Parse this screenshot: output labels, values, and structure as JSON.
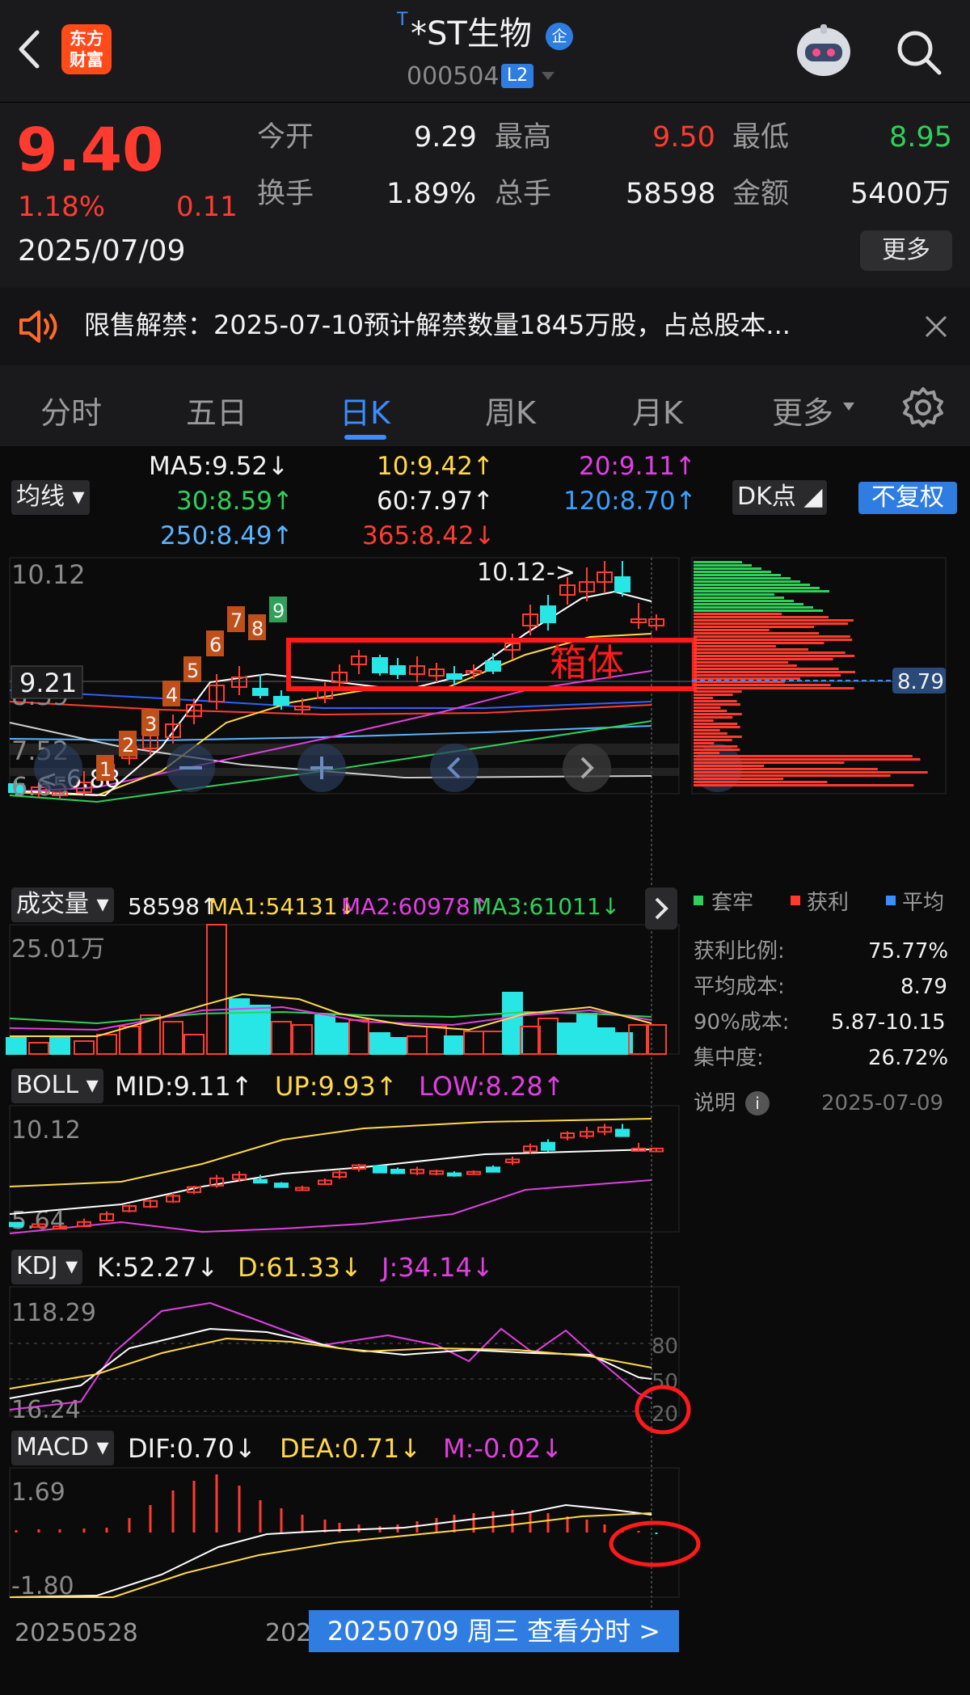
{
  "header": {
    "title_prefix": "T",
    "title": "*ST生物",
    "badge": "企",
    "code": "000504",
    "level": "L2",
    "logo_line1": "东方",
    "logo_line2": "财富"
  },
  "quote": {
    "price": "9.40",
    "change_pct": "1.18%",
    "change": "0.11",
    "date": "2025/07/09",
    "open_label": "今开",
    "open": "9.29",
    "high_label": "最高",
    "high": "9.50",
    "low_label": "最低",
    "low": "8.95",
    "turnover_label": "换手",
    "turnover": "1.89%",
    "volume_label": "总手",
    "volume": "58598",
    "amount_label": "金额",
    "amount": "5400万",
    "more": "更多"
  },
  "notice": {
    "text": "限售解禁：2025-07-10预计解禁数量1845万股，占总股本..."
  },
  "tabs": {
    "t1": "分时",
    "t2": "五日",
    "t3": "日K",
    "t4": "周K",
    "t5": "月K",
    "t6": "更多"
  },
  "ma_bar": {
    "selector": "均线",
    "ma5": "MA5:9.52↓",
    "ma10": "10:9.42↑",
    "ma20": "20:9.11↑",
    "ma30": "30:8.59↑",
    "ma60": "60:7.97↑",
    "ma120": "120:8.70↑",
    "ma250": "250:8.49↑",
    "ma365": "365:8.42↓",
    "dk": "DK点",
    "fq": "不复权"
  },
  "kline": {
    "y_top": "10.12",
    "y_mid": "8.39",
    "y_low": "7.52",
    "y_bot": "6.65",
    "cursor_price": "9.21",
    "max_label": "10.12->",
    "min_label": "<-6.88",
    "annot": "箱体",
    "seq": [
      "1",
      "2",
      "3",
      "4",
      "5",
      "6",
      "7",
      "8",
      "9"
    ]
  },
  "chip": {
    "avg_tag": "8.79",
    "legend_trap": "套牢",
    "legend_profit": "获利",
    "legend_avg": "平均",
    "rows": [
      {
        "label": "获利比例:",
        "value": "75.77%"
      },
      {
        "label": "平均成本:",
        "value": "8.79"
      },
      {
        "label": "90%成本:",
        "value": "5.87-10.15"
      },
      {
        "label": "集中度:",
        "value": "26.72%"
      }
    ],
    "note": "说明",
    "date": "2025-07-09"
  },
  "volume": {
    "selector": "成交量",
    "v": "58598↑",
    "ma1": "MA1:54131↓",
    "ma2": "MA2:60978↑",
    "ma3": "MA3:61011↓",
    "y_top": "25.01万"
  },
  "boll": {
    "selector": "BOLL",
    "mid": "MID:9.11↑",
    "up": "UP:9.93↑",
    "low": "LOW:8.28↑",
    "y_top": "10.12",
    "y_bot": "5.64"
  },
  "kdj": {
    "selector": "KDJ",
    "k": "K:52.27↓",
    "d": "D:61.33↓",
    "j": "J:34.14↓",
    "y_top": "118.29",
    "y_bot": "16.24",
    "lvl80": "80",
    "lvl50": "50",
    "lvl20": "20"
  },
  "macd": {
    "selector": "MACD",
    "dif": "DIF:0.70↓",
    "dea": "DEA:0.71↓",
    "m": "M:-0.02↓",
    "y_top": "1.69",
    "y_bot": "-1.80"
  },
  "footer": {
    "start_date": "20250528",
    "mid_date": "202",
    "cursor": "20250709 周三 查看分时 >"
  },
  "colors": {
    "up": "#ff3b30",
    "down": "#29e6e6",
    "ma5": "#ffffff",
    "ma10": "#ffd84a",
    "ma20": "#e040e0",
    "ma30": "#2fd05a",
    "accent": "#3a8dff"
  }
}
